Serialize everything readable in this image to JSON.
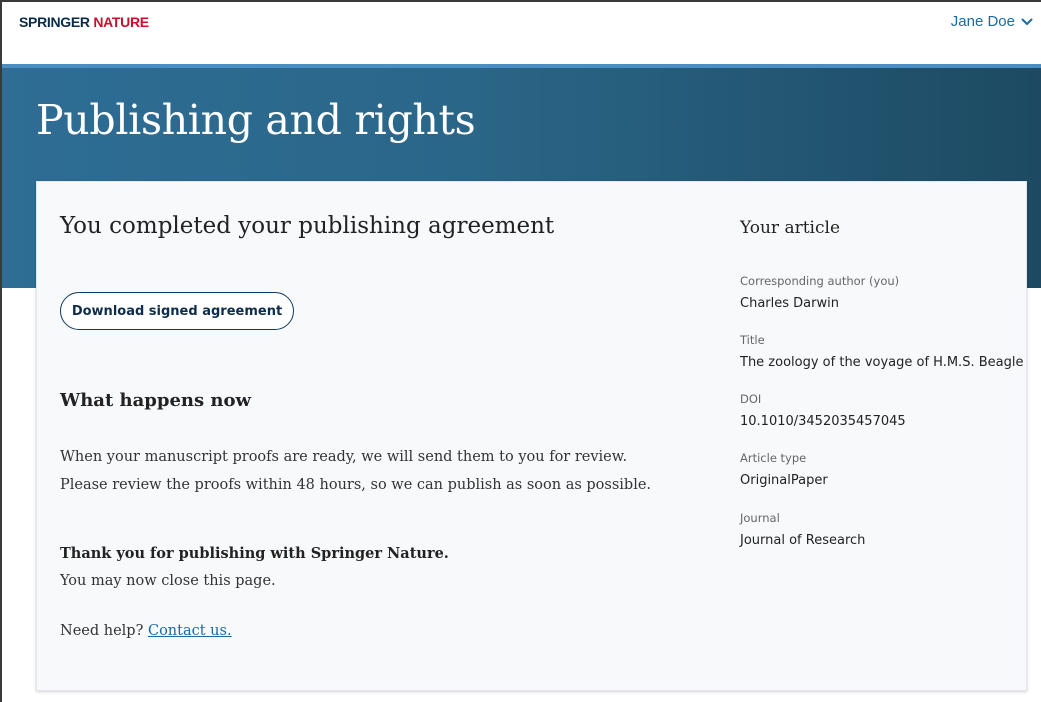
{
  "header": {
    "logo_part1": "SPRINGER",
    "logo_part2": "NATURE",
    "user_name": "Jane Doe",
    "user_menu_icon": "chevron-down-icon"
  },
  "hero": {
    "title": "Publishing and rights"
  },
  "main": {
    "completed_title": "You completed your publishing agreement",
    "download_button": "Download signed agreement",
    "what_happens_heading": "What happens now",
    "what_happens_text": "When your manuscript proofs are ready, we will send them to you for review. Please review the proofs within 48 hours, so we can publish as soon as possible.",
    "thanks": "Thank you for publishing with Springer Nature.",
    "close_note": "You may now close this page.",
    "help_prefix": "Need help?",
    "help_link": "Contact us."
  },
  "article": {
    "heading": "Your article",
    "fields": [
      {
        "label": "Corresponding author (you)",
        "value": "Charles Darwin"
      },
      {
        "label": "Title",
        "value": "The zoology of the voyage of H.M.S. Beagle"
      },
      {
        "label": "DOI",
        "value": "10.1010/3452035457045"
      },
      {
        "label": "Article type",
        "value": "OriginalPaper"
      },
      {
        "label": "Journal",
        "value": "Journal of Research"
      }
    ]
  },
  "colors": {
    "brand_navy": "#0a2a4a",
    "brand_red": "#c8102e",
    "link_blue": "#1b6aa5",
    "hero_left": "#2e6d95",
    "hero_right": "#1d4a62"
  }
}
